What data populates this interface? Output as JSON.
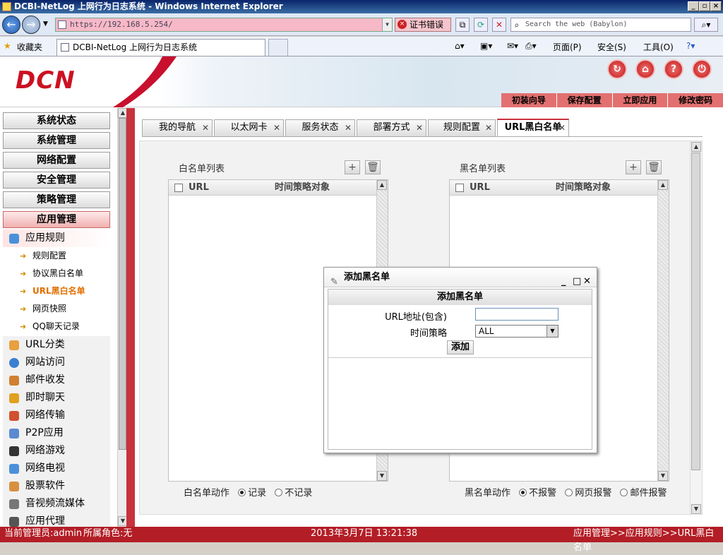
{
  "browser": {
    "window_title": "DCBI-NetLog 上网行为日志系统 - Windows Internet Explorer",
    "url": "https://192.168.5.254/",
    "cert_error": "证书错误",
    "search_placeholder": "Search the web (Babylon)",
    "favorites": "收藏夹",
    "tab_title": "DCBI-NetLog 上网行为日志系统",
    "menu_page": "页面(P)",
    "menu_safety": "安全(S)",
    "menu_tools": "工具(O)"
  },
  "header": {
    "logo": "DCN",
    "nav": [
      "初装向导",
      "保存配置",
      "立即应用",
      "修改密码"
    ]
  },
  "sidebar": {
    "menus": [
      {
        "label": "系统状态"
      },
      {
        "label": "系统管理"
      },
      {
        "label": "网络配置"
      },
      {
        "label": "安全管理"
      },
      {
        "label": "策略管理"
      },
      {
        "label": "应用管理"
      }
    ],
    "app_rules": "应用规则",
    "leaves": [
      "规则配置",
      "协议黑白名单",
      "URL黑白名单",
      "网页快照",
      "QQ聊天记录"
    ],
    "subs": [
      "URL分类",
      "网站访问",
      "邮件收发",
      "即时聊天",
      "网络传输",
      "P2P应用",
      "网络游戏",
      "网络电视",
      "股票软件",
      "音视频流媒体",
      "应用代理"
    ]
  },
  "tabs": [
    "我的导航",
    "以太网卡",
    "服务状态",
    "部署方式",
    "规则配置",
    "URL黑白名单"
  ],
  "whitelist": {
    "title": "白名单列表",
    "col_url": "URL",
    "col_policy": "时间策略对象",
    "action_label": "白名单动作",
    "options": [
      "记录",
      "不记录"
    ]
  },
  "blacklist": {
    "title": "黑名单列表",
    "col_url": "URL",
    "col_policy": "时间策略对象",
    "action_label": "黑名单动作",
    "options": [
      "不报警",
      "网页报警",
      "邮件报警"
    ]
  },
  "dialog": {
    "title": "添加黑名单",
    "form_title": "添加黑名单",
    "url_label": "URL地址(包含)",
    "url_value": "",
    "policy_label": "时间策略",
    "policy_value": "ALL",
    "add_button": "添加"
  },
  "status": {
    "user": "当前管理员:admin",
    "role": "所属角色:无",
    "datetime": "2013年3月7日 13:21:38",
    "path": "应用管理>>应用规则>>URL黑白名单"
  }
}
